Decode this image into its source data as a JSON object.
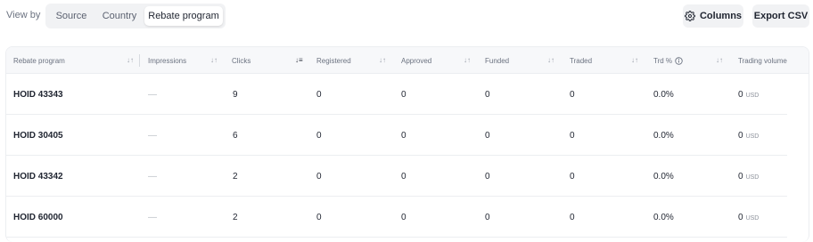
{
  "toolbar": {
    "view_by_label": "View by",
    "tabs": [
      {
        "label": "Source",
        "active": false
      },
      {
        "label": "Country",
        "active": false
      },
      {
        "label": "Rebate program",
        "active": true
      }
    ],
    "columns_label": "Columns",
    "columns_icon": "gear-icon",
    "export_label": "Export CSV"
  },
  "table": {
    "columns": [
      {
        "label": "Rebate program",
        "sort_icon": "sort-icon"
      },
      {
        "label": "Impressions",
        "sort_icon": "sort-icon"
      },
      {
        "label": "Clicks",
        "sort_icon": "sort-desc-icon",
        "sorted": true
      },
      {
        "label": "Registered",
        "sort_icon": "sort-icon"
      },
      {
        "label": "Approved",
        "sort_icon": "sort-icon"
      },
      {
        "label": "Funded",
        "sort_icon": "sort-icon"
      },
      {
        "label": "Traded",
        "sort_icon": "sort-icon"
      },
      {
        "label": "Trd %",
        "sort_icon": "sort-icon",
        "info_icon": "info-icon"
      },
      {
        "label": "Trading volume"
      }
    ],
    "rows": [
      {
        "program": "HOID 43343",
        "impressions": "—",
        "clicks": "9",
        "registered": "0",
        "approved": "0",
        "funded": "0",
        "traded": "0",
        "trd_pct": "0.0%",
        "volume": "0",
        "unit": "USD"
      },
      {
        "program": "HOID 30405",
        "impressions": "—",
        "clicks": "6",
        "registered": "0",
        "approved": "0",
        "funded": "0",
        "traded": "0",
        "trd_pct": "0.0%",
        "volume": "0",
        "unit": "USD"
      },
      {
        "program": "HOID 43342",
        "impressions": "—",
        "clicks": "2",
        "registered": "0",
        "approved": "0",
        "funded": "0",
        "traded": "0",
        "trd_pct": "0.0%",
        "volume": "0",
        "unit": "USD"
      },
      {
        "program": "HOID 60000",
        "impressions": "—",
        "clicks": "2",
        "registered": "0",
        "approved": "0",
        "funded": "0",
        "traded": "0",
        "trd_pct": "0.0%",
        "volume": "0",
        "unit": "USD"
      }
    ]
  },
  "colors": {
    "accent_bg": "#f1f2f4",
    "text": "#1f2430",
    "muted": "#6b7280",
    "border": "#eceef1"
  }
}
